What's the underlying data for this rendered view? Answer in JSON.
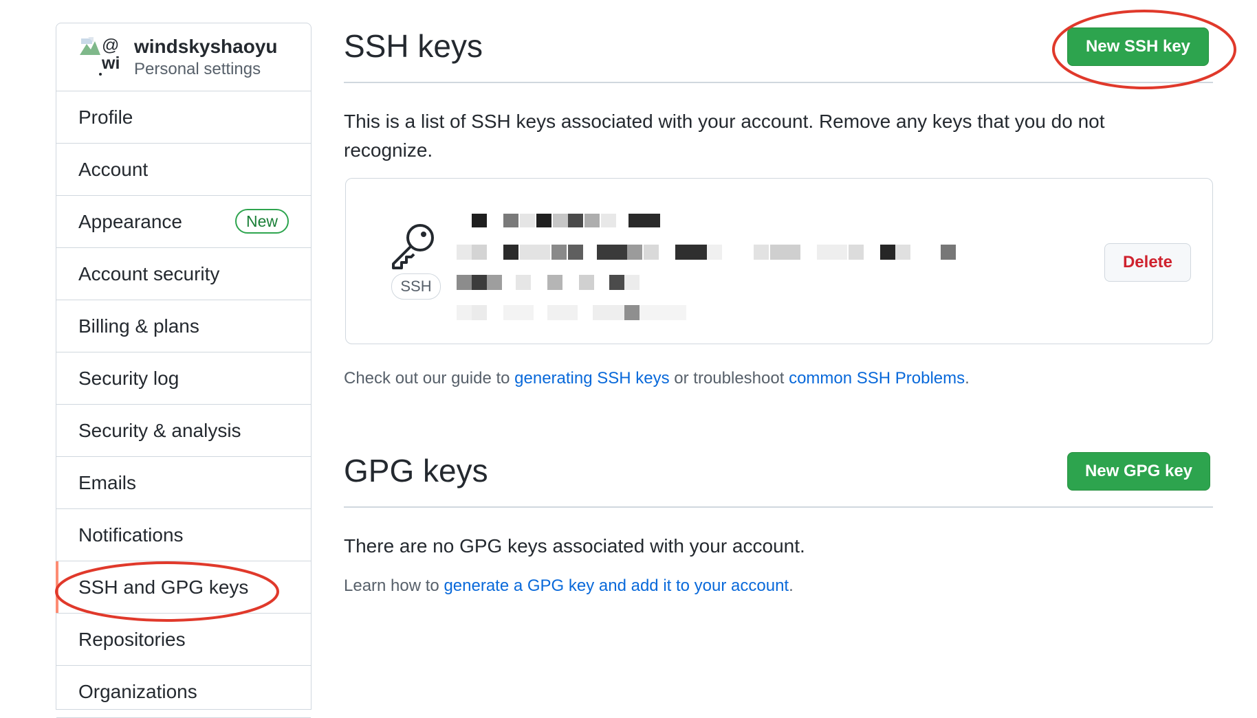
{
  "sidebar": {
    "username": "windskyshaoyu",
    "subtitle": "Personal settings",
    "avatar_alt_line1": "@",
    "avatar_alt_line2": "wi",
    "items": [
      {
        "label": "Profile"
      },
      {
        "label": "Account"
      },
      {
        "label": "Appearance",
        "badge": "New"
      },
      {
        "label": "Account security"
      },
      {
        "label": "Billing & plans"
      },
      {
        "label": "Security log"
      },
      {
        "label": "Security & analysis"
      },
      {
        "label": "Emails"
      },
      {
        "label": "Notifications"
      },
      {
        "label": "SSH and GPG keys",
        "active": true
      },
      {
        "label": "Repositories"
      },
      {
        "label": "Organizations"
      }
    ]
  },
  "ssh": {
    "title": "SSH keys",
    "new_button": "New SSH key",
    "description": "This is a list of SSH keys associated with your account. Remove any keys that you do not recognize.",
    "key_type_label": "SSH",
    "delete_button": "Delete",
    "guide_prefix": "Check out our guide to ",
    "guide_link1": "generating SSH keys",
    "guide_middle": " or troubleshoot ",
    "guide_link2": "common SSH Problems",
    "guide_suffix": "."
  },
  "gpg": {
    "title": "GPG keys",
    "new_button": "New GPG key",
    "empty_text": "There are no GPG keys associated with your account.",
    "learn_prefix": "Learn how to ",
    "learn_link": "generate a GPG key and add it to your account",
    "learn_suffix": "."
  },
  "colors": {
    "primary_button": "#2da44e",
    "link": "#0969da",
    "danger": "#cf222e",
    "annotation": "#e0392b",
    "active_indicator": "#fd8c73"
  }
}
